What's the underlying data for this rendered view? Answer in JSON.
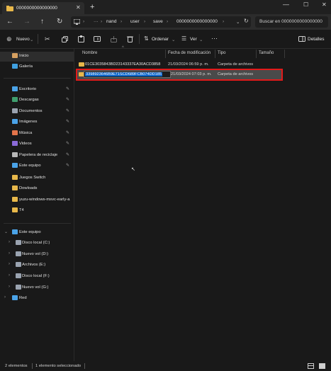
{
  "window": {
    "tab_title": "0000000000000000",
    "new_tab": "+",
    "controls": {
      "minimize": "—",
      "maximize": "☐",
      "close": "✕"
    }
  },
  "address": {
    "more": "···",
    "crumbs": [
      "nand",
      "user",
      "save",
      "0000000000000000"
    ],
    "search_placeholder": "Buscar en 0000000000000000"
  },
  "commands": {
    "new": "Nuevo",
    "sort": "Ordenar",
    "view": "Ver",
    "more": "···",
    "details": "Detalles"
  },
  "sidebar": {
    "top": [
      {
        "label": "Inicio",
        "icon": "home-icon",
        "color": "#d6a060"
      },
      {
        "label": "Galería",
        "icon": "gallery-icon",
        "color": "#3fa0e0"
      }
    ],
    "quick": [
      {
        "label": "Escritorio",
        "icon": "desktop-icon",
        "color": "#4aa3e8"
      },
      {
        "label": "Descargas",
        "icon": "downloads-icon",
        "color": "#3f9e6e"
      },
      {
        "label": "Documentos",
        "icon": "documents-icon",
        "color": "#9aa3b0"
      },
      {
        "label": "Imágenes",
        "icon": "pictures-icon",
        "color": "#4aa3e8"
      },
      {
        "label": "Música",
        "icon": "music-icon",
        "color": "#e3744a"
      },
      {
        "label": "Videos",
        "icon": "videos-icon",
        "color": "#8b6ad8"
      },
      {
        "label": "Papelera de reciclaje",
        "icon": "recycle-bin-icon",
        "color": "#b8b8b8"
      },
      {
        "label": "Este equipo",
        "icon": "this-pc-icon",
        "color": "#4aa3e8"
      },
      {
        "label": "Juegos Switch",
        "icon": "folder-icon",
        "color": "#e8b84a"
      },
      {
        "label": "Dowloads",
        "icon": "folder-icon",
        "color": "#e8b84a"
      },
      {
        "label": "yuzu-windows-msvc-early-a",
        "icon": "folder-icon",
        "color": "#e8b84a"
      },
      {
        "label": "T4",
        "icon": "folder-icon",
        "color": "#e8b84a"
      }
    ],
    "this_pc": {
      "label": "Este equipo",
      "icon": "this-pc-icon",
      "color": "#4aa3e8"
    },
    "drives": [
      {
        "label": "Disco local (C:)",
        "icon": "drive-icon",
        "color": "#9aa3b0"
      },
      {
        "label": "Nuevo vol (D:)",
        "icon": "drive-icon",
        "color": "#9aa3b0"
      },
      {
        "label": "Archivos (E:)",
        "icon": "drive-icon",
        "color": "#9aa3b0"
      },
      {
        "label": "Disco local (F:)",
        "icon": "drive-icon",
        "color": "#9aa3b0"
      },
      {
        "label": "Nuevo vol (G:)",
        "icon": "drive-icon",
        "color": "#9aa3b0"
      }
    ],
    "network": {
      "label": "Red",
      "icon": "network-icon",
      "color": "#4aa3e8"
    }
  },
  "list": {
    "columns": [
      "Nombre",
      "Fecha de modificación",
      "Tipo",
      "Tamaño"
    ],
    "rows": [
      {
        "name": "01CE3035843BD23143337EA30ACD3858",
        "date": "21/03/2024 06:59 p. m.",
        "type": "Carpeta de archivos"
      },
      {
        "name": "3398923646B9E71SCD689FCB074DD185",
        "date": "21/03/2024 07:03 p. m.",
        "type": "Carpeta de archivos"
      }
    ],
    "highlight_color": "#e21a1a"
  },
  "status": {
    "count": "2 elementos",
    "selected": "1 elemento seleccionado"
  }
}
